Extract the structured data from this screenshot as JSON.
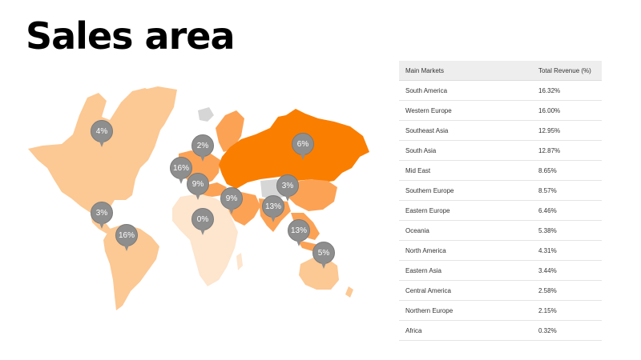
{
  "page": {
    "title": "Sales area"
  },
  "colors": {
    "dark_orange": "#fa7e00",
    "mid_orange": "#fca255",
    "light_orange": "#fcc893",
    "pale_orange": "#fde5ce",
    "gray_land": "#d6d6d6",
    "pin": "#8e8e8e"
  },
  "markers": [
    {
      "label": "4%",
      "region": "North America (Canada)"
    },
    {
      "label": "3%",
      "region": "Central America"
    },
    {
      "label": "16%",
      "region": "South America"
    },
    {
      "label": "2%",
      "region": "Northern Europe"
    },
    {
      "label": "16%",
      "region": "Western Europe"
    },
    {
      "label": "9%",
      "region": "Southern Europe"
    },
    {
      "label": "0%",
      "region": "Africa"
    },
    {
      "label": "9%",
      "region": "Mid East"
    },
    {
      "label": "6%",
      "region": "Eastern Europe"
    },
    {
      "label": "3%",
      "region": "Eastern Asia"
    },
    {
      "label": "13%",
      "region": "South Asia"
    },
    {
      "label": "13%",
      "region": "Southeast Asia"
    },
    {
      "label": "5%",
      "region": "Oceania"
    }
  ],
  "table": {
    "headers": [
      "Main Markets",
      "Total Revenue (%)"
    ],
    "rows": [
      [
        "South America",
        "16.32%"
      ],
      [
        "Western Europe",
        "16.00%"
      ],
      [
        "Southeast Asia",
        "12.95%"
      ],
      [
        "South Asia",
        "12.87%"
      ],
      [
        "Mid East",
        "8.65%"
      ],
      [
        "Southern Europe",
        "8.57%"
      ],
      [
        "Eastern Europe",
        "6.46%"
      ],
      [
        "Oceania",
        "5.38%"
      ],
      [
        "North America",
        "4.31%"
      ],
      [
        "Eastern Asia",
        "3.44%"
      ],
      [
        "Central America",
        "2.58%"
      ],
      [
        "Northern Europe",
        "2.15%"
      ],
      [
        "Africa",
        "0.32%"
      ]
    ]
  }
}
